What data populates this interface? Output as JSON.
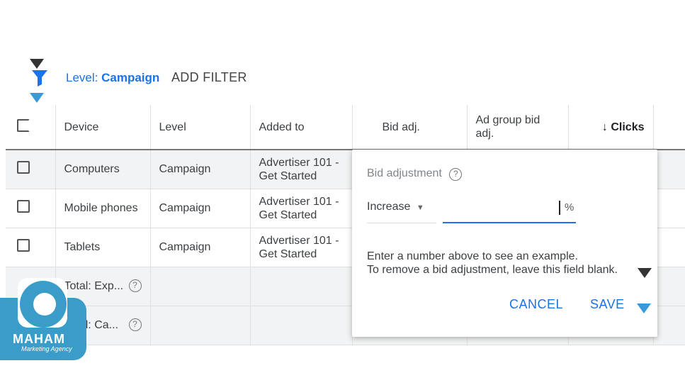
{
  "filter": {
    "level_label": "Level:",
    "level_value": "Campaign",
    "add_filter": "ADD FILTER"
  },
  "table": {
    "headers": [
      "Device",
      "Level",
      "Added to",
      "Bid adj.",
      "Ad group bid adj.",
      "Clicks"
    ],
    "rows": [
      {
        "device": "Computers",
        "level": "Campaign",
        "added_to": "Advertiser 101 - Get Started"
      },
      {
        "device": "Mobile phones",
        "level": "Campaign",
        "added_to": "Advertiser 101 - Get Started"
      },
      {
        "device": "Tablets",
        "level": "Campaign",
        "added_to": "Advertiser 101 - Get Started"
      }
    ],
    "totals": [
      "Total: Exp...",
      "Total: Ca..."
    ]
  },
  "popup": {
    "title": "Bid adjustment",
    "direction": "Increase",
    "value": "",
    "unit": "%",
    "hint1": "Enter a number above to see an example.",
    "hint2": "To remove a bid adjustment, leave this field blank.",
    "cancel": "CANCEL",
    "save": "SAVE"
  },
  "logo": {
    "name": "MAHAM",
    "tagline": "Marketing Agency",
    "color": "#3a9cc8"
  },
  "colors": {
    "accent": "#1a73e8",
    "marker": "#3a9ad9"
  }
}
